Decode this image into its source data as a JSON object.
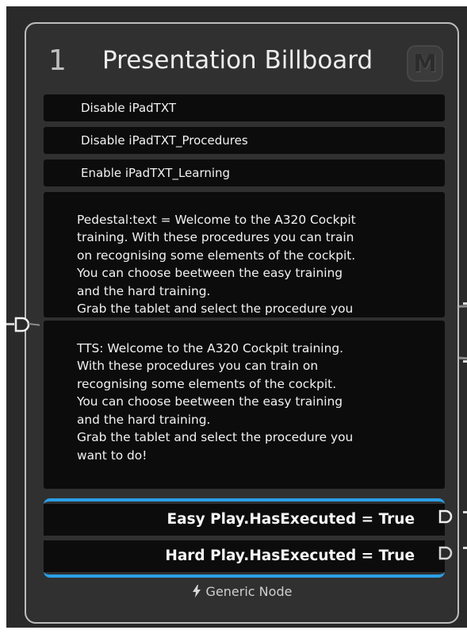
{
  "node": {
    "number": "1",
    "title": "Presentation Billboard",
    "badge": "M",
    "actions": [
      {
        "label": "Disable iPadTXT"
      },
      {
        "label": "Disable iPadTXT_Procedures"
      },
      {
        "label": "Enable iPadTXT_Learning"
      }
    ],
    "texts": [
      {
        "content": "Pedestal:text = Welcome to the A320 Cockpit\ntraining. With these procedures you can train\non recognising some elements of the cockpit.\nYou can choose beetween the easy training\nand the hard training.\nGrab the tablet and select the procedure you\nwant to do!"
      },
      {
        "content": "TTS: Welcome to the A320 Cockpit training.\nWith these procedures you can train on\nrecognising some elements of the cockpit.\nYou can choose beetween the easy training\nand the hard training.\nGrab the tablet and select the procedure you\nwant to do!"
      }
    ],
    "conditions": [
      {
        "label": "Easy Play.HasExecuted = True"
      },
      {
        "label": "Hard Play.HasExecuted = True"
      }
    ],
    "footer": "Generic Node",
    "port_icon": "D",
    "colors": {
      "accent": "#2a9fe6",
      "node_bg": "#303030",
      "row_bg": "#0c0c0c",
      "border": "#bdbdbd"
    }
  }
}
